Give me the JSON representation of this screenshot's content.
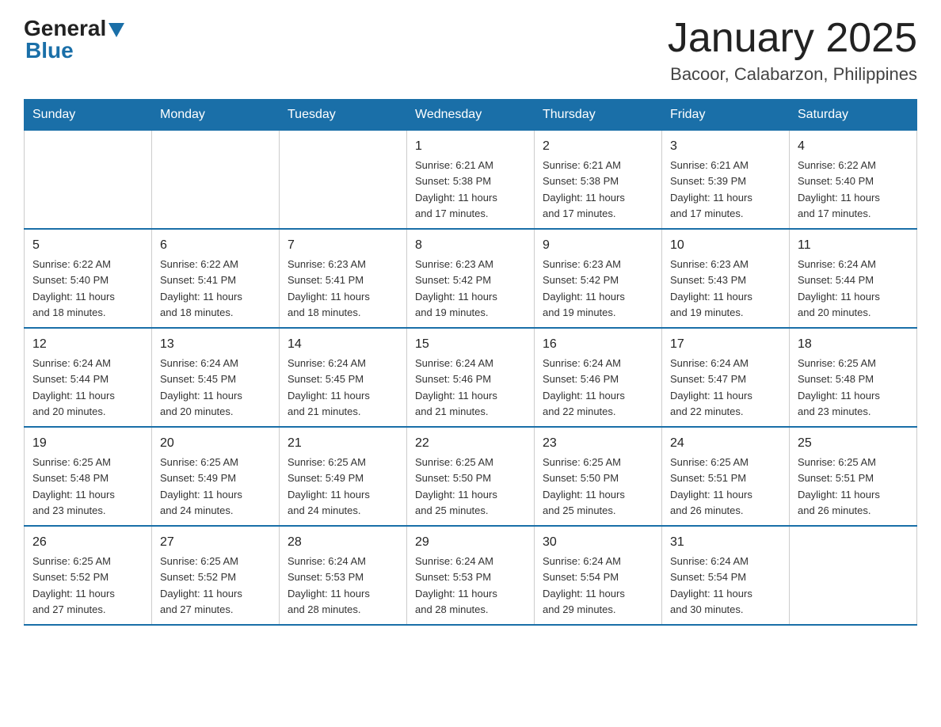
{
  "header": {
    "logo_general": "General",
    "logo_blue": "Blue",
    "title": "January 2025",
    "subtitle": "Bacoor, Calabarzon, Philippines"
  },
  "calendar": {
    "days_of_week": [
      "Sunday",
      "Monday",
      "Tuesday",
      "Wednesday",
      "Thursday",
      "Friday",
      "Saturday"
    ],
    "weeks": [
      {
        "cells": [
          {
            "day": "",
            "info": ""
          },
          {
            "day": "",
            "info": ""
          },
          {
            "day": "",
            "info": ""
          },
          {
            "day": "1",
            "info": "Sunrise: 6:21 AM\nSunset: 5:38 PM\nDaylight: 11 hours\nand 17 minutes."
          },
          {
            "day": "2",
            "info": "Sunrise: 6:21 AM\nSunset: 5:38 PM\nDaylight: 11 hours\nand 17 minutes."
          },
          {
            "day": "3",
            "info": "Sunrise: 6:21 AM\nSunset: 5:39 PM\nDaylight: 11 hours\nand 17 minutes."
          },
          {
            "day": "4",
            "info": "Sunrise: 6:22 AM\nSunset: 5:40 PM\nDaylight: 11 hours\nand 17 minutes."
          }
        ]
      },
      {
        "cells": [
          {
            "day": "5",
            "info": "Sunrise: 6:22 AM\nSunset: 5:40 PM\nDaylight: 11 hours\nand 18 minutes."
          },
          {
            "day": "6",
            "info": "Sunrise: 6:22 AM\nSunset: 5:41 PM\nDaylight: 11 hours\nand 18 minutes."
          },
          {
            "day": "7",
            "info": "Sunrise: 6:23 AM\nSunset: 5:41 PM\nDaylight: 11 hours\nand 18 minutes."
          },
          {
            "day": "8",
            "info": "Sunrise: 6:23 AM\nSunset: 5:42 PM\nDaylight: 11 hours\nand 19 minutes."
          },
          {
            "day": "9",
            "info": "Sunrise: 6:23 AM\nSunset: 5:42 PM\nDaylight: 11 hours\nand 19 minutes."
          },
          {
            "day": "10",
            "info": "Sunrise: 6:23 AM\nSunset: 5:43 PM\nDaylight: 11 hours\nand 19 minutes."
          },
          {
            "day": "11",
            "info": "Sunrise: 6:24 AM\nSunset: 5:44 PM\nDaylight: 11 hours\nand 20 minutes."
          }
        ]
      },
      {
        "cells": [
          {
            "day": "12",
            "info": "Sunrise: 6:24 AM\nSunset: 5:44 PM\nDaylight: 11 hours\nand 20 minutes."
          },
          {
            "day": "13",
            "info": "Sunrise: 6:24 AM\nSunset: 5:45 PM\nDaylight: 11 hours\nand 20 minutes."
          },
          {
            "day": "14",
            "info": "Sunrise: 6:24 AM\nSunset: 5:45 PM\nDaylight: 11 hours\nand 21 minutes."
          },
          {
            "day": "15",
            "info": "Sunrise: 6:24 AM\nSunset: 5:46 PM\nDaylight: 11 hours\nand 21 minutes."
          },
          {
            "day": "16",
            "info": "Sunrise: 6:24 AM\nSunset: 5:46 PM\nDaylight: 11 hours\nand 22 minutes."
          },
          {
            "day": "17",
            "info": "Sunrise: 6:24 AM\nSunset: 5:47 PM\nDaylight: 11 hours\nand 22 minutes."
          },
          {
            "day": "18",
            "info": "Sunrise: 6:25 AM\nSunset: 5:48 PM\nDaylight: 11 hours\nand 23 minutes."
          }
        ]
      },
      {
        "cells": [
          {
            "day": "19",
            "info": "Sunrise: 6:25 AM\nSunset: 5:48 PM\nDaylight: 11 hours\nand 23 minutes."
          },
          {
            "day": "20",
            "info": "Sunrise: 6:25 AM\nSunset: 5:49 PM\nDaylight: 11 hours\nand 24 minutes."
          },
          {
            "day": "21",
            "info": "Sunrise: 6:25 AM\nSunset: 5:49 PM\nDaylight: 11 hours\nand 24 minutes."
          },
          {
            "day": "22",
            "info": "Sunrise: 6:25 AM\nSunset: 5:50 PM\nDaylight: 11 hours\nand 25 minutes."
          },
          {
            "day": "23",
            "info": "Sunrise: 6:25 AM\nSunset: 5:50 PM\nDaylight: 11 hours\nand 25 minutes."
          },
          {
            "day": "24",
            "info": "Sunrise: 6:25 AM\nSunset: 5:51 PM\nDaylight: 11 hours\nand 26 minutes."
          },
          {
            "day": "25",
            "info": "Sunrise: 6:25 AM\nSunset: 5:51 PM\nDaylight: 11 hours\nand 26 minutes."
          }
        ]
      },
      {
        "cells": [
          {
            "day": "26",
            "info": "Sunrise: 6:25 AM\nSunset: 5:52 PM\nDaylight: 11 hours\nand 27 minutes."
          },
          {
            "day": "27",
            "info": "Sunrise: 6:25 AM\nSunset: 5:52 PM\nDaylight: 11 hours\nand 27 minutes."
          },
          {
            "day": "28",
            "info": "Sunrise: 6:24 AM\nSunset: 5:53 PM\nDaylight: 11 hours\nand 28 minutes."
          },
          {
            "day": "29",
            "info": "Sunrise: 6:24 AM\nSunset: 5:53 PM\nDaylight: 11 hours\nand 28 minutes."
          },
          {
            "day": "30",
            "info": "Sunrise: 6:24 AM\nSunset: 5:54 PM\nDaylight: 11 hours\nand 29 minutes."
          },
          {
            "day": "31",
            "info": "Sunrise: 6:24 AM\nSunset: 5:54 PM\nDaylight: 11 hours\nand 30 minutes."
          },
          {
            "day": "",
            "info": ""
          }
        ]
      }
    ]
  }
}
